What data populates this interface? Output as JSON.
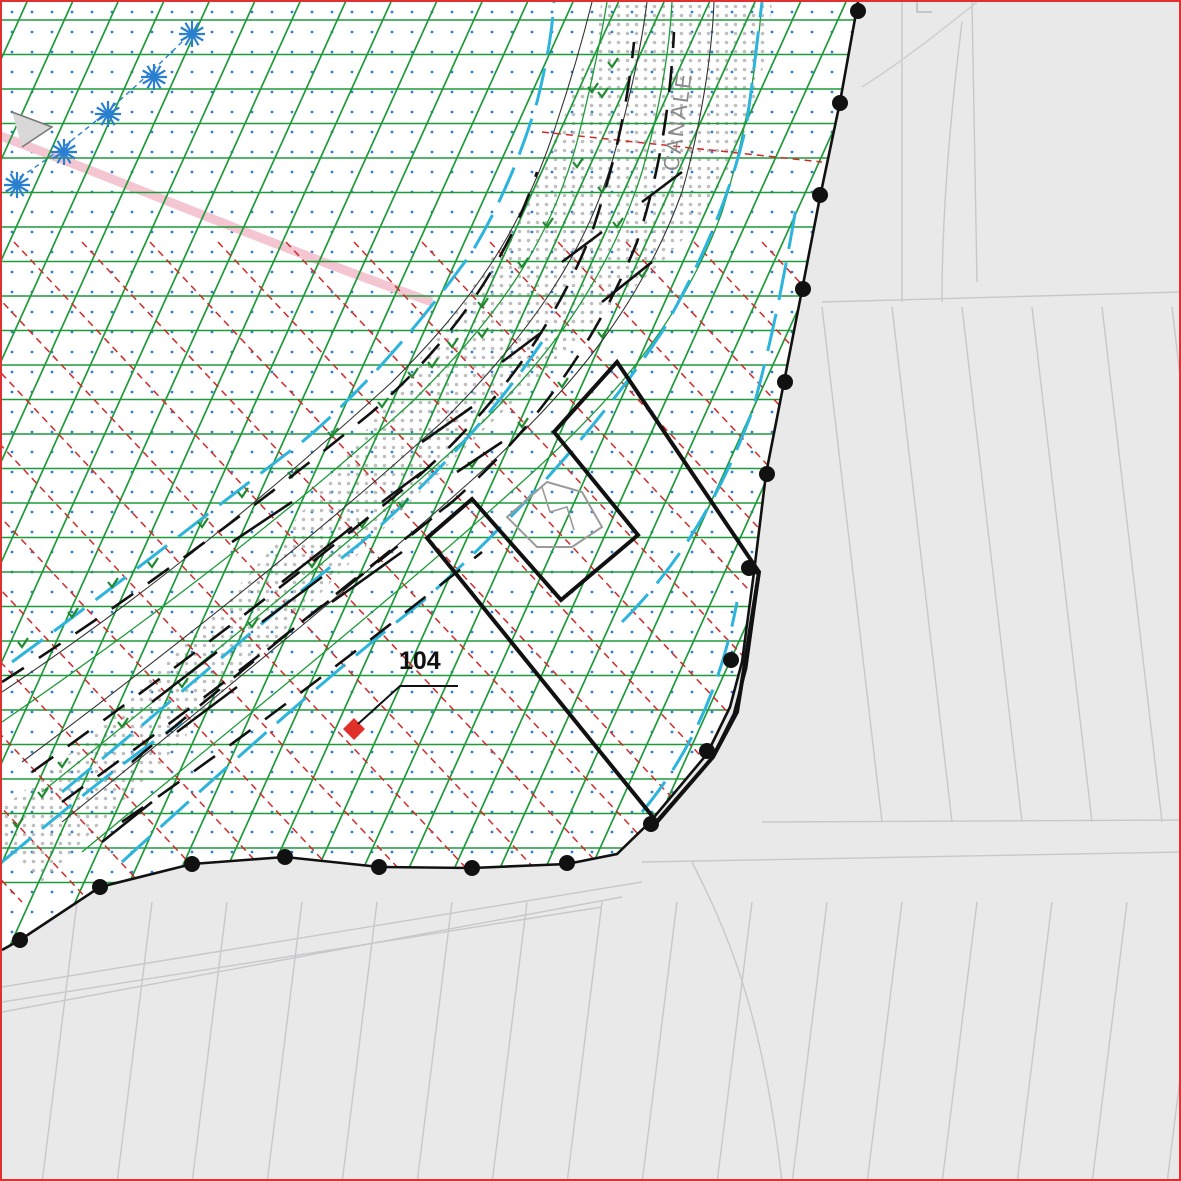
{
  "map": {
    "labels": {
      "parcel_number": "104",
      "canal_name": "CANALE"
    },
    "colors": {
      "frame_border": "#e03030",
      "outside_area": "#e9e9ea",
      "zone_fill": "#ffffff",
      "hatch_green": "#1f9a3a",
      "dot_blue": "#2f7fd0",
      "contour_cyan": "#2cb4dc",
      "red_dashed": "#d02a2a",
      "boundary_black": "#111111",
      "tree_symbol": "#2a7fd0",
      "parcel_marker": "#e0302a",
      "pink_trail": "#f3c6d2"
    },
    "icons": {
      "boundary_vertex": "black-dot-icon",
      "tree": "asterisk-tree-icon",
      "parcel_point": "red-diamond-icon"
    }
  }
}
